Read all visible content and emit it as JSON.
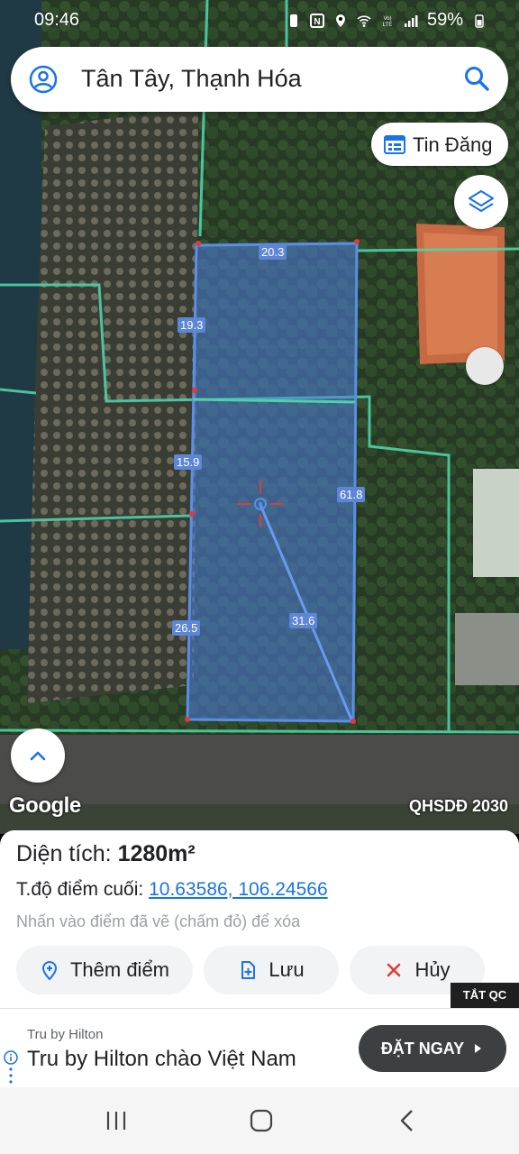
{
  "status_bar": {
    "time": "09:46",
    "battery": "59%",
    "icons": [
      "battery-saver-icon",
      "nfc-icon",
      "location-icon",
      "wifi-icon",
      "volte-icon",
      "signal-icon",
      "battery-icon"
    ]
  },
  "search": {
    "title": "Tân Tây, Thạnh Hóa",
    "left_icon": "account-icon",
    "right_icon": "search-icon"
  },
  "map": {
    "tin_dang_label": "Tin Đăng",
    "watermark": "Google",
    "overlay_label": "QHSDĐ 2030",
    "segments": [
      {
        "id": "top",
        "value": "20.3"
      },
      {
        "id": "left-upper",
        "value": "19.3"
      },
      {
        "id": "left-middle",
        "value": "15.9"
      },
      {
        "id": "left-lower",
        "value": "26.5"
      },
      {
        "id": "right",
        "value": "61.8"
      },
      {
        "id": "diagonal",
        "value": "31.6"
      }
    ],
    "colors": {
      "plot_fill": "#4f7fe0",
      "plot_stroke": "#5a8fe8",
      "parcel_line": "#4fd2a8",
      "vertex": "#e03a3a"
    }
  },
  "panel": {
    "area_label": "Diện tích:",
    "area_value": "1280m²",
    "coord_label": "T.độ điểm cuối:",
    "coord_value": "10.63586, 106.24566",
    "hint": "Nhấn vào điểm đã vẽ (chấm đỏ) để xóa",
    "add_point_label": "Thêm điểm",
    "save_label": "Lưu",
    "cancel_label": "Hủy"
  },
  "ad": {
    "close_label": "TẮT QC",
    "advertiser": "Tru by Hilton",
    "headline": "Tru by Hilton chào Việt Nam",
    "cta": "ĐẶT NGAY"
  },
  "navbar": {
    "icons": [
      "recents-icon",
      "home-icon",
      "back-icon"
    ]
  }
}
